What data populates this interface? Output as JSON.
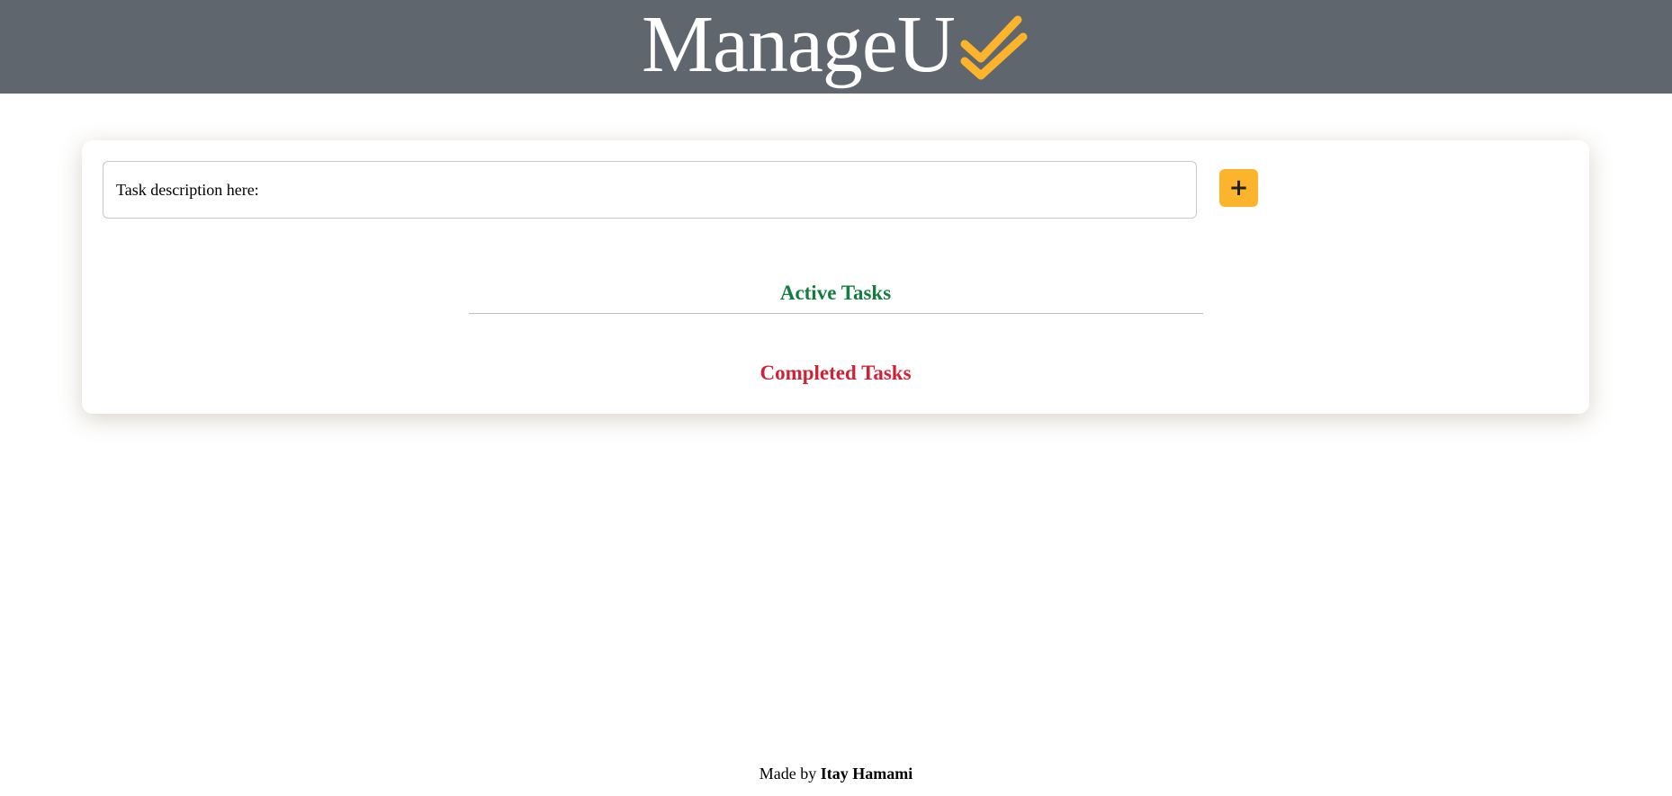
{
  "header": {
    "brand_name": "ManageU",
    "brand_icon": "double-check-icon",
    "background_color": "#5f666e",
    "icon_color": "#fbb42c"
  },
  "task_form": {
    "input_placeholder": "Task description here:",
    "input_value": "",
    "add_button_label": "+",
    "add_button_color": "#fbb42c"
  },
  "sections": {
    "active_title": "Active Tasks",
    "active_color": "#137c3e",
    "active_tasks": [],
    "completed_title": "Completed Tasks",
    "completed_color": "#cf2335",
    "completed_tasks": []
  },
  "footer": {
    "prefix": "Made by",
    "author": "Itay Hamami"
  }
}
